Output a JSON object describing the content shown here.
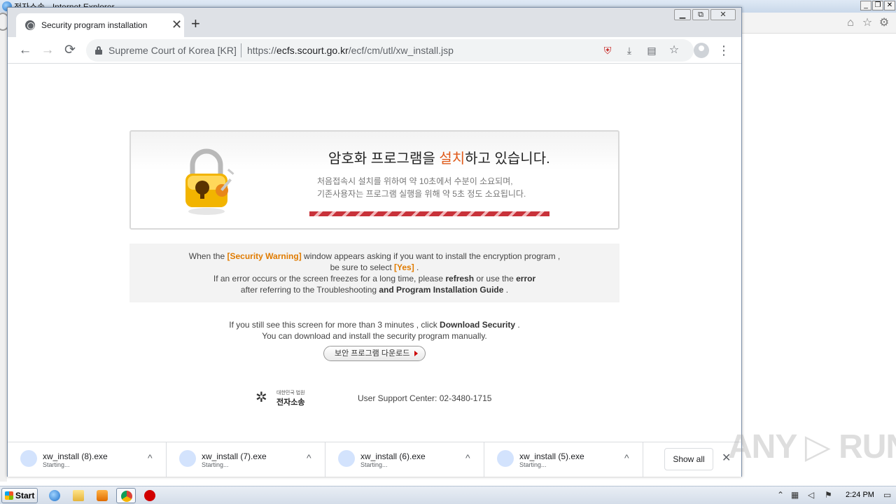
{
  "ie": {
    "title": "전자소송 - Internet Explorer",
    "controls": {
      "minimize": "_",
      "restore": "❐",
      "close": "✕"
    }
  },
  "chrome": {
    "tab": {
      "title": "Security program installation",
      "close": "✕"
    },
    "new_tab": "+",
    "window_controls": {
      "minimize": "▁",
      "restore": "⧉",
      "close": "✕"
    },
    "nav": {
      "back": "←",
      "forward": "→",
      "reload": "⟳"
    },
    "omnibox": {
      "site_name": "Supreme Court of Korea [KR]",
      "url_scheme": "https://",
      "url_host": "ecfs.scourt.go.kr",
      "url_path": "/ecf/cm/utl/xw_install.jsp"
    },
    "menu": "⋮"
  },
  "page": {
    "install": {
      "title_before": "암호화 프로그램을 ",
      "title_accent": "설치",
      "title_after": "하고 있습니다.",
      "desc_line1": "처음접속시 설치를 위하여 약 10초에서 수분이 소요되며,",
      "desc_line2": "기존사용자는 프로그램 실행을 위해 약 5초 정도 소요됩니다."
    },
    "notice": {
      "l1_pre": "When the ",
      "l1_hl": "[Security Warning]",
      "l1_post": " window appears asking if you want to install the encryption program ,",
      "l2_pre": "be sure to select ",
      "l2_hl": "[Yes]",
      "l2_post": " .",
      "l3_pre": "If an error occurs or the screen freezes for a long time, please ",
      "l3_b1": "refresh",
      "l3_mid": " or use the ",
      "l3_b2": "error",
      "l4_pre": "after referring to the Troubleshooting ",
      "l4_b": "and Program Installation Guide",
      "l4_post": " ."
    },
    "info": {
      "l1_pre": "If you still see this screen for more than 3 minutes , click ",
      "l1_b": "Download Security",
      "l1_post": " .",
      "l2": "You can download and install the security program manually."
    },
    "download_button": "보안 프로그램 다운로드",
    "logo": {
      "small": "대한민국 법원",
      "big": "전자소송"
    },
    "support": "User Support Center: 02-3480-1715"
  },
  "downloads": {
    "items": [
      {
        "name": "xw_install (8).exe",
        "status": "Starting..."
      },
      {
        "name": "xw_install (7).exe",
        "status": "Starting..."
      },
      {
        "name": "xw_install (6).exe",
        "status": "Starting..."
      },
      {
        "name": "xw_install (5).exe",
        "status": "Starting..."
      }
    ],
    "chevron": "^",
    "show_all": "Show all",
    "close": "✕"
  },
  "watermark": "ANY ▷ RUN",
  "taskbar": {
    "start": "Start",
    "clock": "2:24 PM"
  },
  "colors": {
    "accent_orange": "#e05a1a",
    "highlight_orange": "#e07b00",
    "progress_red": "#c8323a"
  }
}
